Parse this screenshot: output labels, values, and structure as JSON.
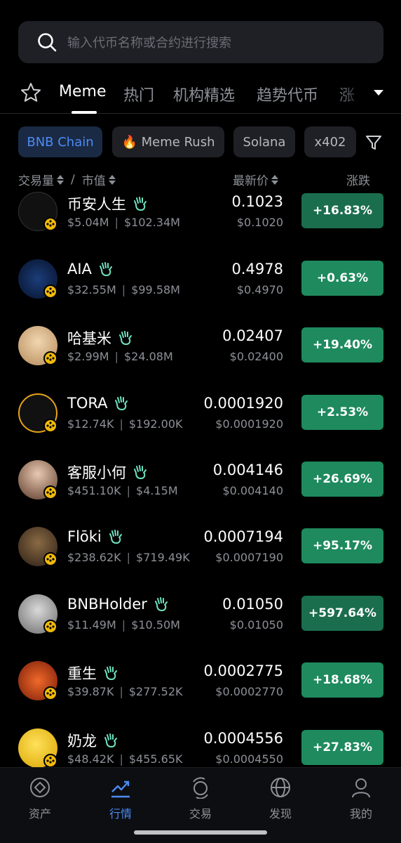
{
  "search": {
    "placeholder": "输入代币名称或合约进行搜索"
  },
  "tabs": [
    {
      "label": "Meme"
    },
    {
      "label": "热门"
    },
    {
      "label": "机构精选"
    },
    {
      "label": "趋势代币"
    },
    {
      "label": "涨"
    }
  ],
  "chips": [
    {
      "label": "BNB Chain"
    },
    {
      "label": "🔥 Meme Rush"
    },
    {
      "label": "Solana"
    },
    {
      "label": "x402"
    }
  ],
  "header": {
    "volume": "交易量",
    "separator": "/",
    "mcap": "市值",
    "price": "最新价",
    "change": "涨跌"
  },
  "tokens": [
    {
      "name": "币安人生",
      "volume": "$5.04M",
      "mcap": "$102.34M",
      "price": "0.1023",
      "price_usd": "$0.1020",
      "change": "+16.83%"
    },
    {
      "name": "AIA",
      "volume": "$32.55M",
      "mcap": "$99.58M",
      "price": "0.4978",
      "price_usd": "$0.4970",
      "change": "+0.63%"
    },
    {
      "name": "哈基米",
      "volume": "$2.99M",
      "mcap": "$24.08M",
      "price": "0.02407",
      "price_usd": "$0.02400",
      "change": "+19.40%"
    },
    {
      "name": "TORA",
      "volume": "$12.74K",
      "mcap": "$192.00K",
      "price": "0.0001920",
      "price_usd": "$0.0001920",
      "change": "+2.53%"
    },
    {
      "name": "客服小何",
      "volume": "$451.10K",
      "mcap": "$4.15M",
      "price": "0.004146",
      "price_usd": "$0.004140",
      "change": "+26.69%"
    },
    {
      "name": "Flōki",
      "volume": "$238.62K",
      "mcap": "$719.49K",
      "price": "0.0007194",
      "price_usd": "$0.0007190",
      "change": "+95.17%"
    },
    {
      "name": "BNBHolder",
      "volume": "$11.49M",
      "mcap": "$10.50M",
      "price": "0.01050",
      "price_usd": "$0.01050",
      "change": "+597.64%"
    },
    {
      "name": "重生",
      "volume": "$39.87K",
      "mcap": "$277.52K",
      "price": "0.0002775",
      "price_usd": "$0.0002770",
      "change": "+18.68%"
    },
    {
      "name": "奶龙",
      "volume": "$48.42K",
      "mcap": "$455.65K",
      "price": "0.0004556",
      "price_usd": "$0.0004550",
      "change": "+27.83%"
    }
  ],
  "nav": [
    {
      "label": "资产",
      "icon": "assets-icon"
    },
    {
      "label": "行情",
      "icon": "markets-icon"
    },
    {
      "label": "交易",
      "icon": "trade-icon"
    },
    {
      "label": "发现",
      "icon": "discover-icon"
    },
    {
      "label": "我的",
      "icon": "profile-icon"
    }
  ],
  "colors": {
    "positive": "#1e8a5e",
    "accent": "#4c8bf5",
    "background": "#000000"
  }
}
